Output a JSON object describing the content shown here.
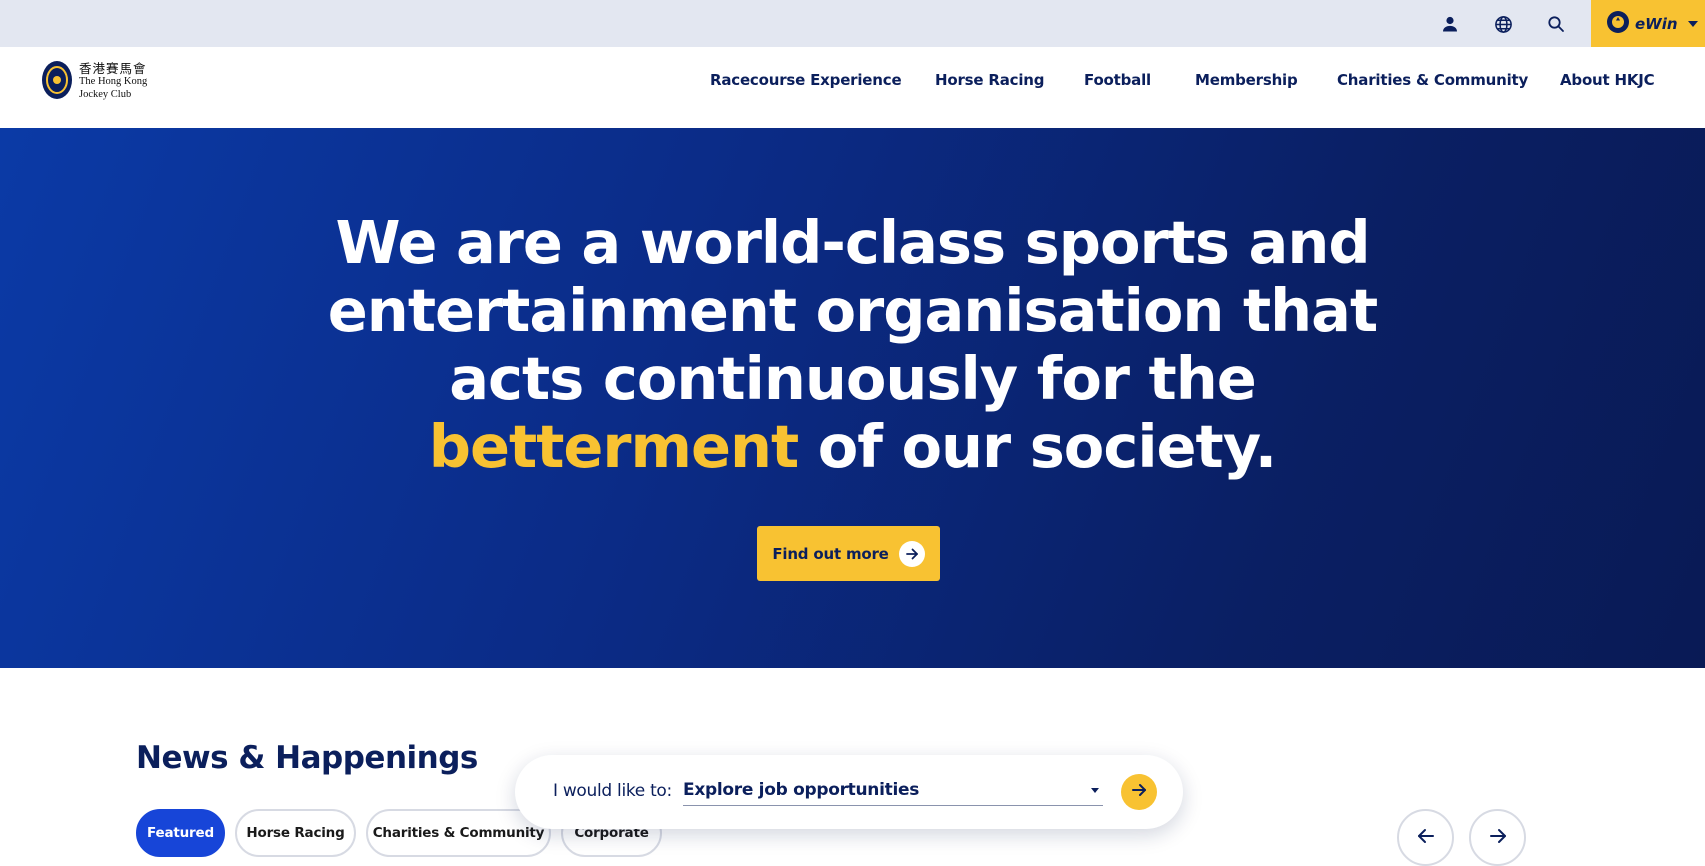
{
  "utility": {
    "icons": [
      "user-icon",
      "globe-icon",
      "search-icon"
    ],
    "ewin_label": "eWin"
  },
  "logo": {
    "chinese": "香港賽馬會",
    "line1": "The Hong Kong",
    "line2": "Jockey Club"
  },
  "nav": {
    "items": [
      {
        "label": "Racecourse Experience"
      },
      {
        "label": "Horse Racing"
      },
      {
        "label": "Football"
      },
      {
        "label": "Membership"
      },
      {
        "label": "Charities & Community"
      },
      {
        "label": "About HKJC"
      }
    ]
  },
  "hero": {
    "line1": "We are a world-class sports and",
    "line2": "entertainment organisation that",
    "line3": "acts continuously for the",
    "highlight": "betterment",
    "line4_rest": " of our society.",
    "cta_label": "Find out more"
  },
  "news": {
    "title": "News & Happenings",
    "chips": [
      {
        "label": "Featured",
        "active": true
      },
      {
        "label": "Horse Racing",
        "active": false
      },
      {
        "label": "Charities & Community",
        "active": false
      },
      {
        "label": "Corporate",
        "active": false
      }
    ]
  },
  "selector": {
    "label": "I would like to:",
    "value": "Explore job opportunities"
  },
  "colors": {
    "navy": "#0b1f5c",
    "gold": "#f8c232",
    "hero_blue": "#0b2b86",
    "chip_active": "#1745d8",
    "utility_bg": "#e3e7f1"
  }
}
